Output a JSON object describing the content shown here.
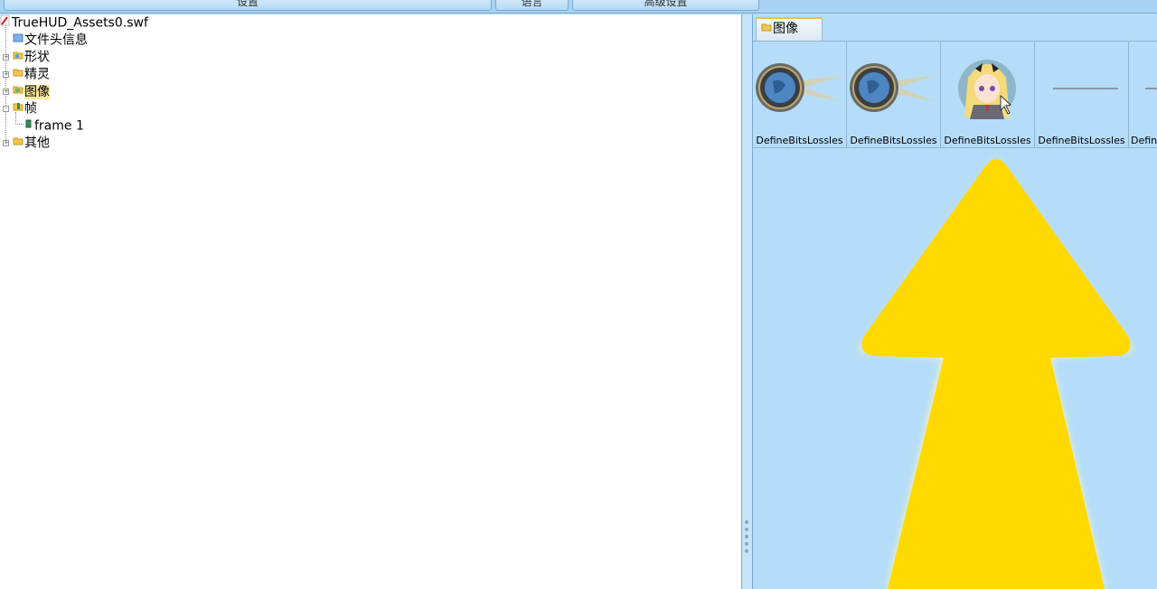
{
  "toolbar": {
    "buttons": [
      "设置",
      "语言",
      "高级设置"
    ]
  },
  "tree": {
    "root": "TrueHUD_Assets0.swf",
    "items": [
      {
        "label": "文件头信息",
        "icon": "header-icon"
      },
      {
        "label": "形状",
        "icon": "folder-icon"
      },
      {
        "label": "精灵",
        "icon": "folder-icon"
      },
      {
        "label": "图像",
        "icon": "folder-icon",
        "selected": true
      },
      {
        "label": "帧",
        "icon": "frame-folder-icon",
        "expanded": true
      },
      {
        "label": "frame 1",
        "icon": "frame-icon",
        "child": true
      },
      {
        "label": "其他",
        "icon": "folder-icon"
      }
    ]
  },
  "right": {
    "tab_label": "图像",
    "thumbnails": [
      {
        "label": "DefineBitsLossles",
        "content": "globe-icon"
      },
      {
        "label": "DefineBitsLossles",
        "content": "globe-icon"
      },
      {
        "label": "DefineBitsLossles",
        "content": "anime-girl-portrait"
      },
      {
        "label": "DefineBitsLossles",
        "content": "thin-line"
      },
      {
        "label": "Defin",
        "content": "thin-line"
      }
    ]
  },
  "colors": {
    "arrow": "#ffd900",
    "selection": "#fbe89a",
    "panel_bg": "#b5ddf9"
  }
}
